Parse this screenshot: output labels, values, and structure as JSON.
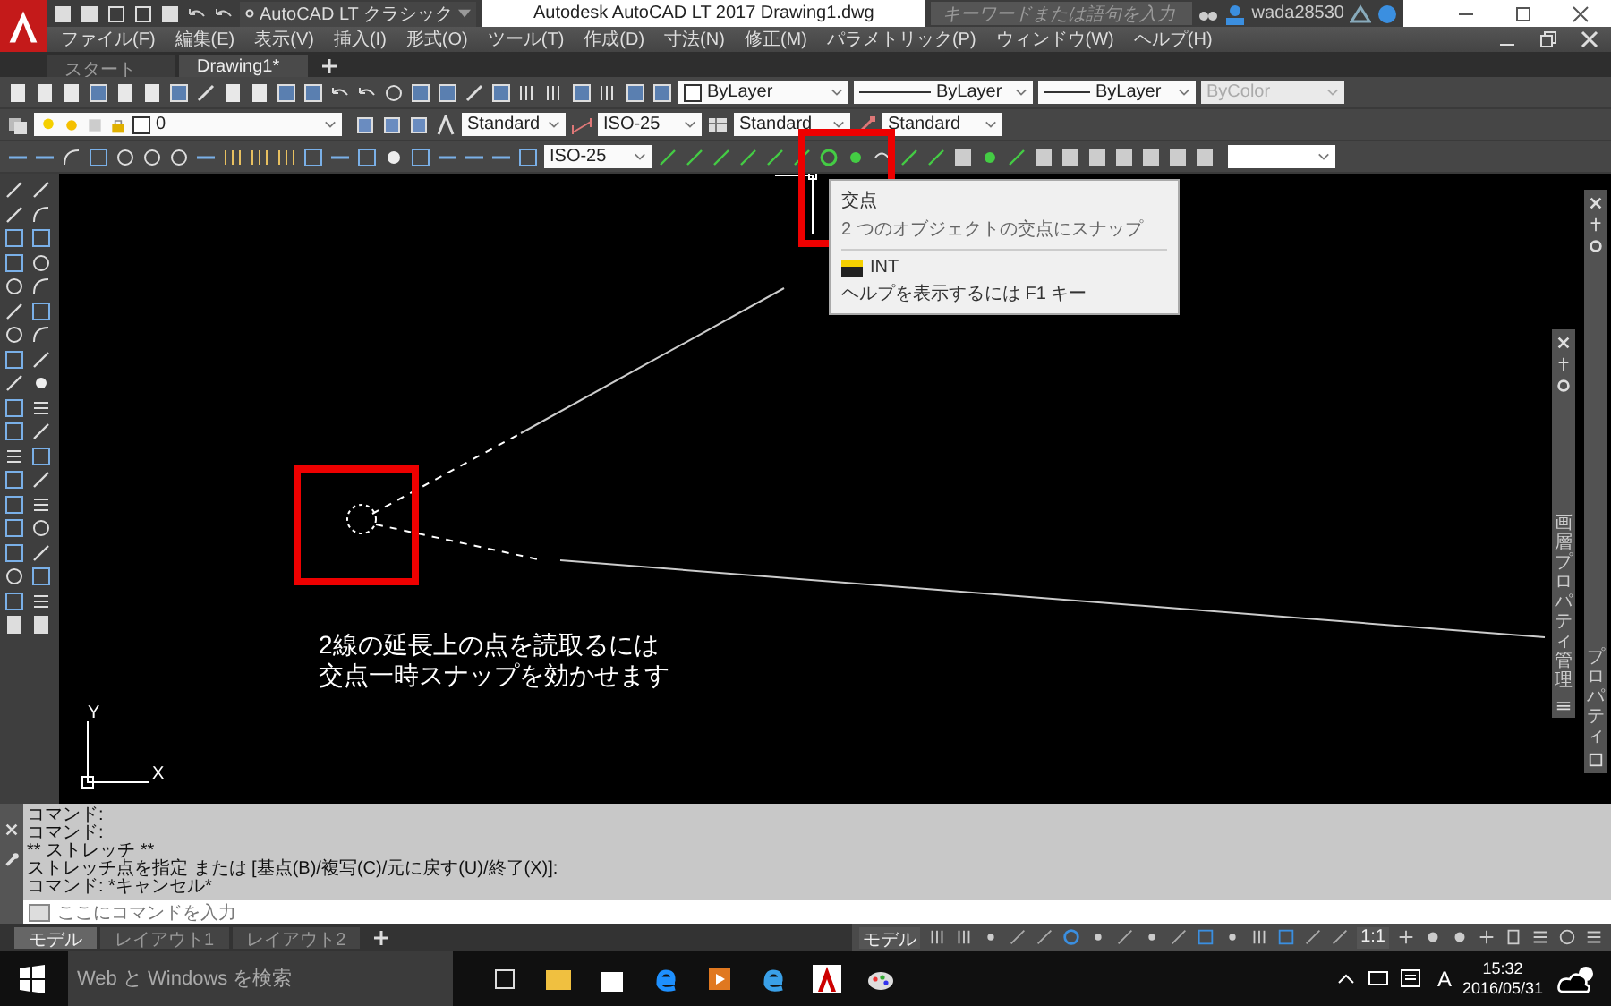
{
  "title_bar": {
    "workspace": "AutoCAD LT クラシック",
    "title": "Autodesk AutoCAD LT 2017    Drawing1.dwg",
    "search": {
      "placeholder": "キーワードまたは語句を入力"
    },
    "user": "wada28530"
  },
  "menu": [
    "ファイル(F)",
    "編集(E)",
    "表示(V)",
    "挿入(I)",
    "形式(O)",
    "ツール(T)",
    "作成(D)",
    "寸法(N)",
    "修正(M)",
    "パラメトリック(P)",
    "ウィンドウ(W)",
    "ヘルプ(H)"
  ],
  "doc_tabs": [
    {
      "label": "スタート",
      "selected": false
    },
    {
      "label": "Drawing1*",
      "selected": true
    }
  ],
  "toolbars": {
    "color_control": "ByLayer",
    "linetype": "ByLayer",
    "lineweight": "ByLayer",
    "plot_style": {
      "value": "ByColor",
      "disabled": true
    },
    "layer": "0",
    "text_style": "Standard",
    "dim_style": "ISO-25",
    "table_style": "Standard",
    "mleader_style": "Standard",
    "dim_style_2": "ISO-25"
  },
  "tooltip": {
    "title": "交点",
    "description": "2 つのオブジェクトの交点にスナップ",
    "command": "INT",
    "help": "ヘルプを表示するには F1 キー"
  },
  "caption": [
    "2線の延長上の点を読取るには",
    "交点一時スナップを効かせます"
  ],
  "ucs": {
    "x": "X",
    "y": "Y"
  },
  "palettes": [
    "プロパティ",
    "画層プロパティ管理"
  ],
  "command_history": [
    "コマンド:",
    "コマンド:",
    "** ストレッチ **",
    "ストレッチ点を指定 または [基点(B)/複写(C)/元に戻す(U)/終了(X)]:",
    "コマンド: *キャンセル*"
  ],
  "command_input": {
    "placeholder": "ここにコマンドを入力"
  },
  "layout_tabs": [
    {
      "label": "モデル",
      "selected": true
    },
    {
      "label": "レイアウト1",
      "selected": false
    },
    {
      "label": "レイアウト2",
      "selected": false
    }
  ],
  "status_bar": {
    "model": "モデル",
    "scale": "1:1"
  },
  "taskbar": {
    "search_placeholder": "Web と Windows を検索",
    "ime": "A",
    "time": "15:32",
    "date": "2016/05/31"
  }
}
